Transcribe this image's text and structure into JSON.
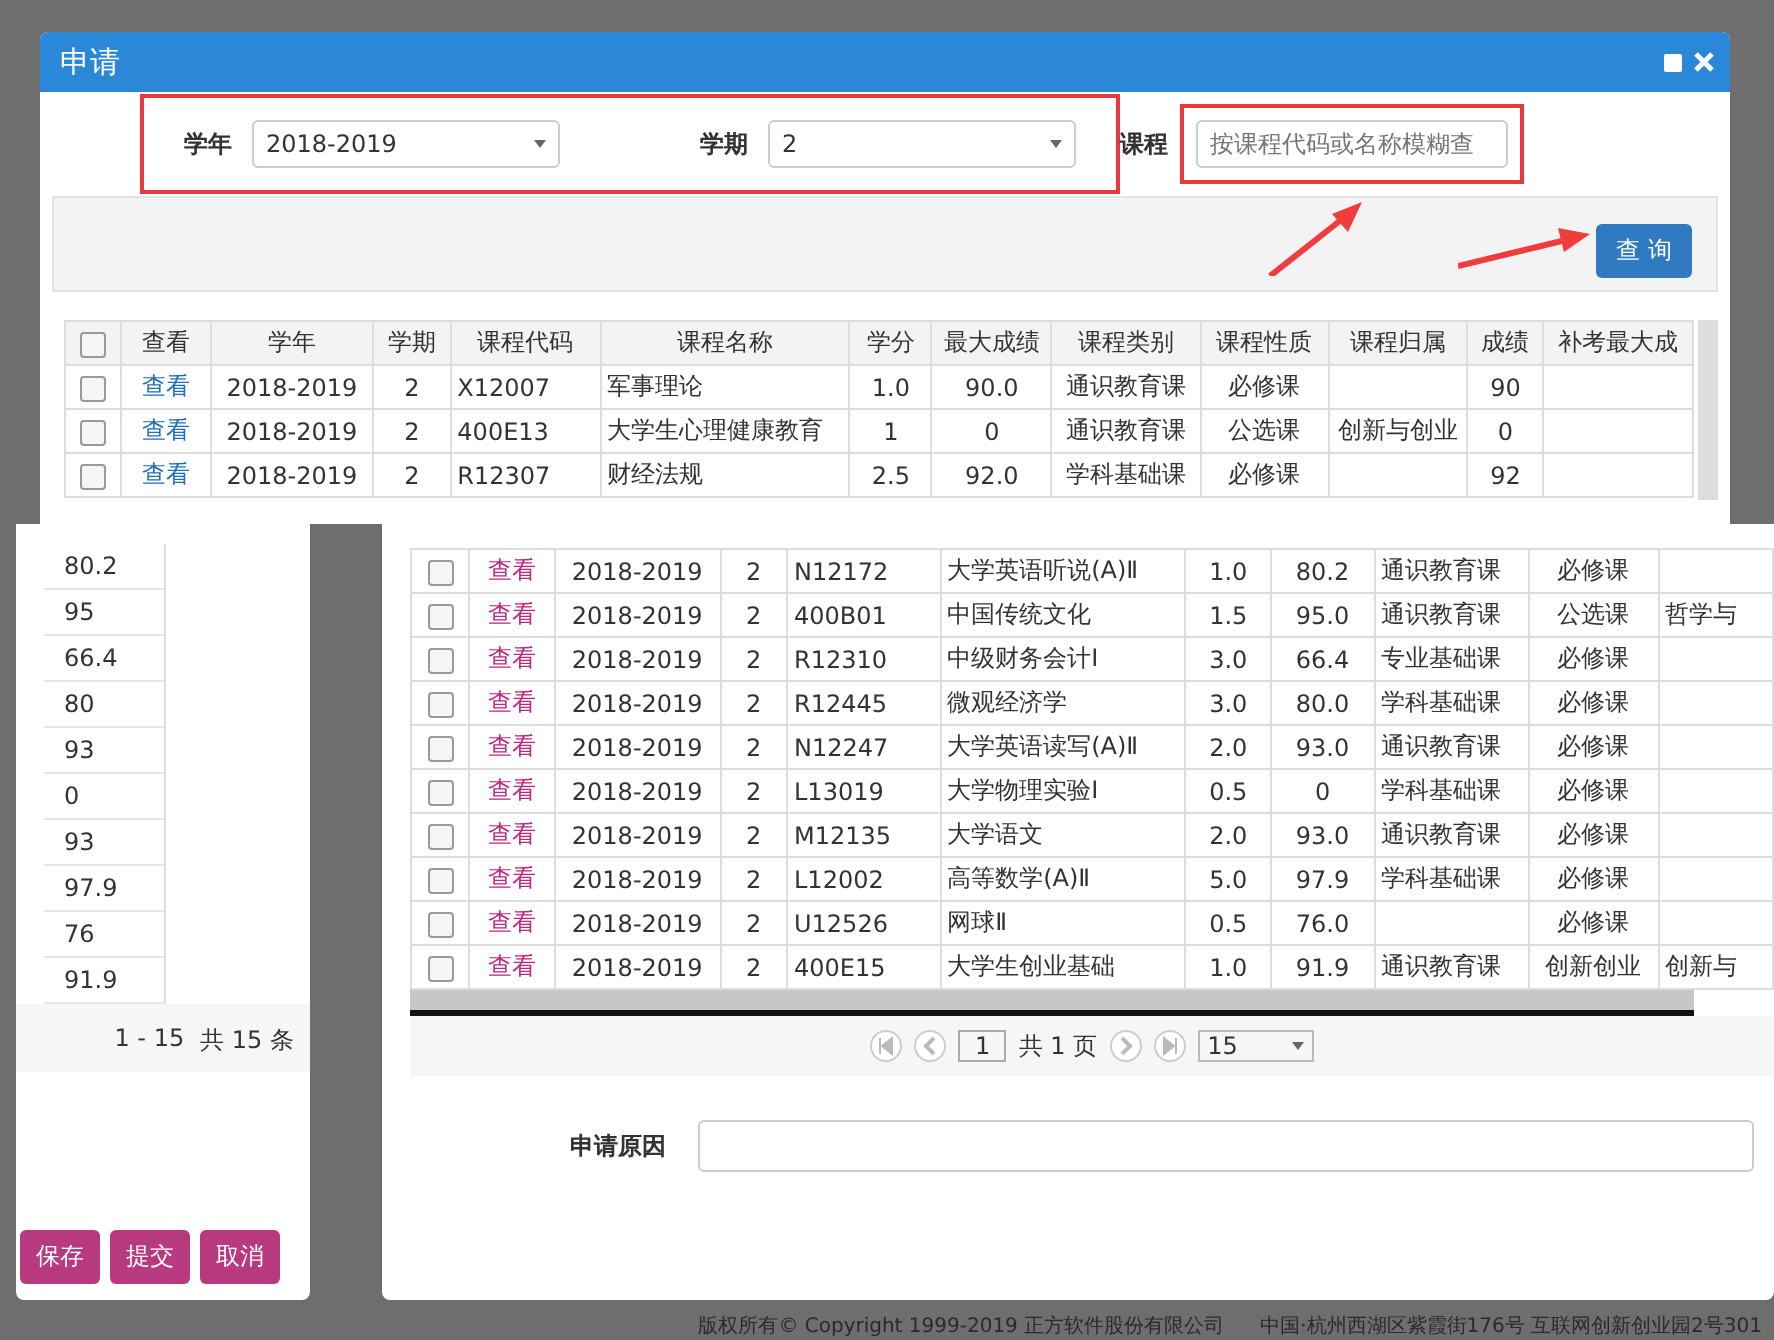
{
  "dialog": {
    "title": "申请",
    "filters": [
      {
        "label": "学年",
        "value": "2018-2019"
      },
      {
        "label": "学期",
        "value": "2"
      }
    ],
    "course_filter": {
      "label": "课程",
      "placeholder": "按课程代码或名称模糊查"
    },
    "query_button": "查 询",
    "table": {
      "select_all_checked": false,
      "columns": [
        "查看",
        "学年",
        "学期",
        "课程代码",
        "课程名称",
        "学分",
        "最大成绩",
        "课程类别",
        "课程性质",
        "课程归属",
        "成绩",
        "补考最大成"
      ],
      "rows": [
        {
          "checked": false,
          "cells": [
            "查看",
            "2018-2019",
            "2",
            "X12007",
            "军事理论",
            "1.0",
            "90.0",
            "通识教育课",
            "必修课",
            "",
            "90",
            ""
          ]
        },
        {
          "checked": false,
          "cells": [
            "查看",
            "2018-2019",
            "2",
            "400E13",
            "大学生心理健康教育",
            "1",
            "0",
            "通识教育课",
            "公选课",
            "创新与创业",
            "0",
            ""
          ]
        },
        {
          "checked": false,
          "cells": [
            "查看",
            "2018-2019",
            "2",
            "R12307",
            "财经法规",
            "2.5",
            "92.0",
            "学科基础课",
            "必修课",
            "",
            "92",
            ""
          ]
        }
      ]
    }
  },
  "left_window": {
    "scores": [
      "80.2",
      "95",
      "66.4",
      "80",
      "93",
      "0",
      "93",
      "97.9",
      "76",
      "91.9"
    ],
    "pager": {
      "range": "1 - 15",
      "total": "共 15 条"
    },
    "buttons": [
      "保存",
      "提交",
      "取消"
    ]
  },
  "result_window": {
    "rows": [
      {
        "checked": false,
        "cells": [
          "查看",
          "2018-2019",
          "2",
          "N12172",
          "大学英语听说(A)Ⅱ",
          "1.0",
          "80.2",
          "通识教育课",
          "必修课",
          ""
        ]
      },
      {
        "checked": false,
        "cells": [
          "查看",
          "2018-2019",
          "2",
          "400B01",
          "中国传统文化",
          "1.5",
          "95.0",
          "通识教育课",
          "公选课",
          "哲学与"
        ]
      },
      {
        "checked": false,
        "cells": [
          "查看",
          "2018-2019",
          "2",
          "R12310",
          "中级财务会计Ⅰ",
          "3.0",
          "66.4",
          "专业基础课",
          "必修课",
          ""
        ]
      },
      {
        "checked": false,
        "cells": [
          "查看",
          "2018-2019",
          "2",
          "R12445",
          "微观经济学",
          "3.0",
          "80.0",
          "学科基础课",
          "必修课",
          ""
        ]
      },
      {
        "checked": false,
        "cells": [
          "查看",
          "2018-2019",
          "2",
          "N12247",
          "大学英语读写(A)Ⅱ",
          "2.0",
          "93.0",
          "通识教育课",
          "必修课",
          ""
        ]
      },
      {
        "checked": false,
        "cells": [
          "查看",
          "2018-2019",
          "2",
          "L13019",
          "大学物理实验Ⅰ",
          "0.5",
          "0",
          "学科基础课",
          "必修课",
          ""
        ]
      },
      {
        "checked": false,
        "cells": [
          "查看",
          "2018-2019",
          "2",
          "M12135",
          "大学语文",
          "2.0",
          "93.0",
          "通识教育课",
          "必修课",
          ""
        ]
      },
      {
        "checked": false,
        "cells": [
          "查看",
          "2018-2019",
          "2",
          "L12002",
          "高等数学(A)Ⅱ",
          "5.0",
          "97.9",
          "学科基础课",
          "必修课",
          ""
        ]
      },
      {
        "checked": false,
        "cells": [
          "查看",
          "2018-2019",
          "2",
          "U12526",
          "网球Ⅱ",
          "0.5",
          "76.0",
          "",
          "必修课",
          ""
        ]
      },
      {
        "checked": false,
        "cells": [
          "查看",
          "2018-2019",
          "2",
          "400E15",
          "大学生创业基础",
          "1.0",
          "91.9",
          "通识教育课",
          "创新创业",
          "创新与"
        ]
      }
    ],
    "pager": {
      "page": "1",
      "pages": "共 1 页",
      "page_size": "15"
    },
    "reason": {
      "label": "申请原因"
    }
  },
  "footer": [
    "版权所有© Copyright 1999-2019 正方软件股份有限公司",
    "中国·杭州西湖区紫霞街176号 互联网创新创业园2号301"
  ]
}
